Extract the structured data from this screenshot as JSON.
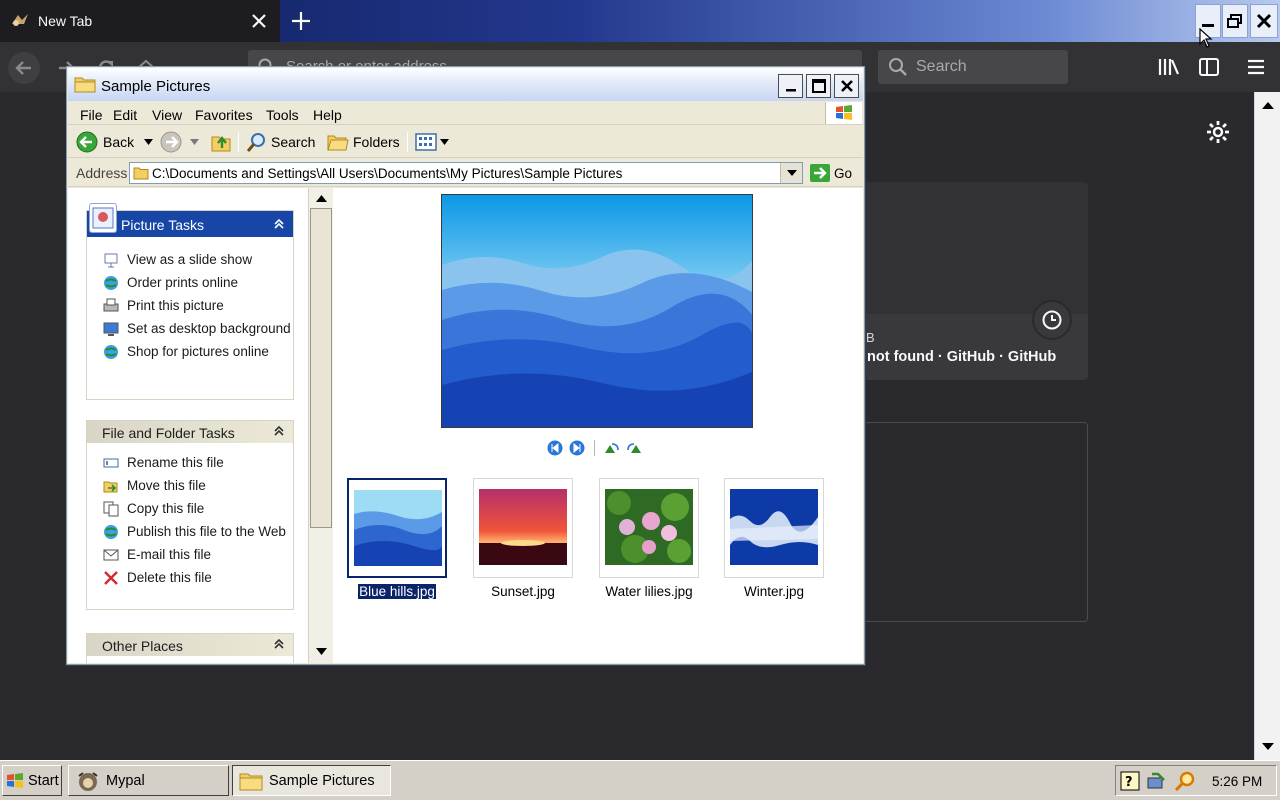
{
  "browser": {
    "tab_title": "New Tab",
    "url_placeholder": "Search or enter address",
    "search_placeholder": "Search",
    "top_site_line1": "B",
    "top_site_line2": "not found · GitHub · GitHub"
  },
  "explorer": {
    "title": "Sample Pictures",
    "menu": [
      "File",
      "Edit",
      "View",
      "Favorites",
      "Tools",
      "Help"
    ],
    "toolbar": {
      "back": "Back",
      "search": "Search",
      "folders": "Folders"
    },
    "address_label": "Address",
    "address": "C:\\Documents and Settings\\All Users\\Documents\\My Pictures\\Sample Pictures",
    "go_label": "Go",
    "picture_tasks": {
      "title": "Picture Tasks",
      "items": [
        "View as a slide show",
        "Order prints online",
        "Print this picture",
        "Set as desktop background",
        "Shop for pictures online"
      ]
    },
    "file_tasks": {
      "title": "File and Folder Tasks",
      "items": [
        "Rename this file",
        "Move this file",
        "Copy this file",
        "Publish this file to the Web",
        "E-mail this file",
        "Delete this file"
      ]
    },
    "other_places": {
      "title": "Other Places"
    },
    "files": [
      {
        "name": "Blue hills.jpg",
        "selected": true
      },
      {
        "name": "Sunset.jpg",
        "selected": false
      },
      {
        "name": "Water lilies.jpg",
        "selected": false
      },
      {
        "name": "Winter.jpg",
        "selected": false
      }
    ]
  },
  "taskbar": {
    "start_label": "Start",
    "buttons": [
      "Mypal",
      "Sample Pictures"
    ],
    "active_button": "Sample Pictures",
    "clock": "5:26 PM"
  }
}
